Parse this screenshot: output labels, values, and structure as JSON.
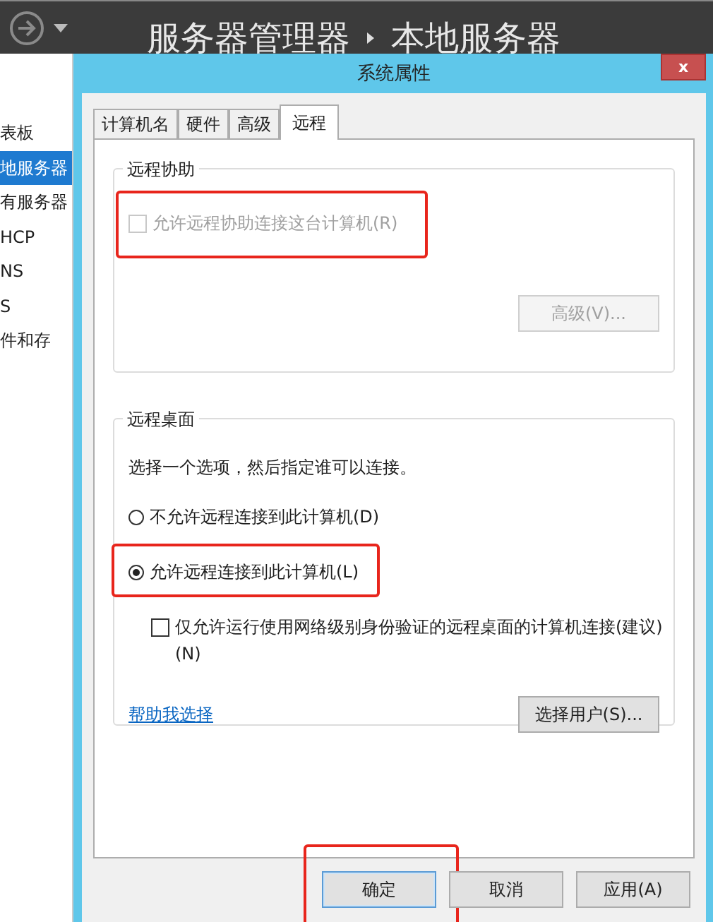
{
  "app": {
    "title": "服务器管理器",
    "breadcrumb": "本地服务器"
  },
  "sidebar": {
    "items": [
      {
        "label": "表板",
        "selected": false
      },
      {
        "label": "地服务器",
        "selected": true
      },
      {
        "label": "有服务器",
        "selected": false
      },
      {
        "label": "HCP",
        "selected": false
      },
      {
        "label": "NS",
        "selected": false
      },
      {
        "label": "S",
        "selected": false
      },
      {
        "label": "件和存",
        "selected": false
      }
    ]
  },
  "dialog": {
    "title": "系统属性",
    "close": "x",
    "tabs": [
      {
        "label": "计算机名",
        "selected": false
      },
      {
        "label": "硬件",
        "selected": false
      },
      {
        "label": "高级",
        "selected": false
      },
      {
        "label": "远程",
        "selected": true
      }
    ],
    "remote_assistance": {
      "title": "远程协助",
      "checkbox": {
        "label": "允许远程协助连接这台计算机(R)",
        "checked": false,
        "disabled": true,
        "highlighted": true
      },
      "advanced_button": {
        "label": "高级(V)...",
        "disabled": true
      }
    },
    "remote_desktop": {
      "title": "远程桌面",
      "instruction": "选择一个选项，然后指定谁可以连接。",
      "options": [
        {
          "label": "不允许远程连接到此计算机(D)",
          "selected": false,
          "highlighted": false
        },
        {
          "label": "允许远程连接到此计算机(L)",
          "selected": true,
          "highlighted": true
        }
      ],
      "nla_checkbox": {
        "label": "仅允许运行使用网络级别身份验证的远程桌面的计算机连接(建议)",
        "label_2": "(N)",
        "checked": false,
        "disabled": false
      },
      "help_link": "帮助我选择",
      "select_users_button": "选择用户(S)..."
    },
    "buttons": [
      {
        "label": "确定",
        "focused": true,
        "highlighted": true
      },
      {
        "label": "取消",
        "focused": false,
        "highlighted": false
      },
      {
        "label": "应用(A)",
        "focused": false,
        "highlighted": false
      }
    ]
  }
}
